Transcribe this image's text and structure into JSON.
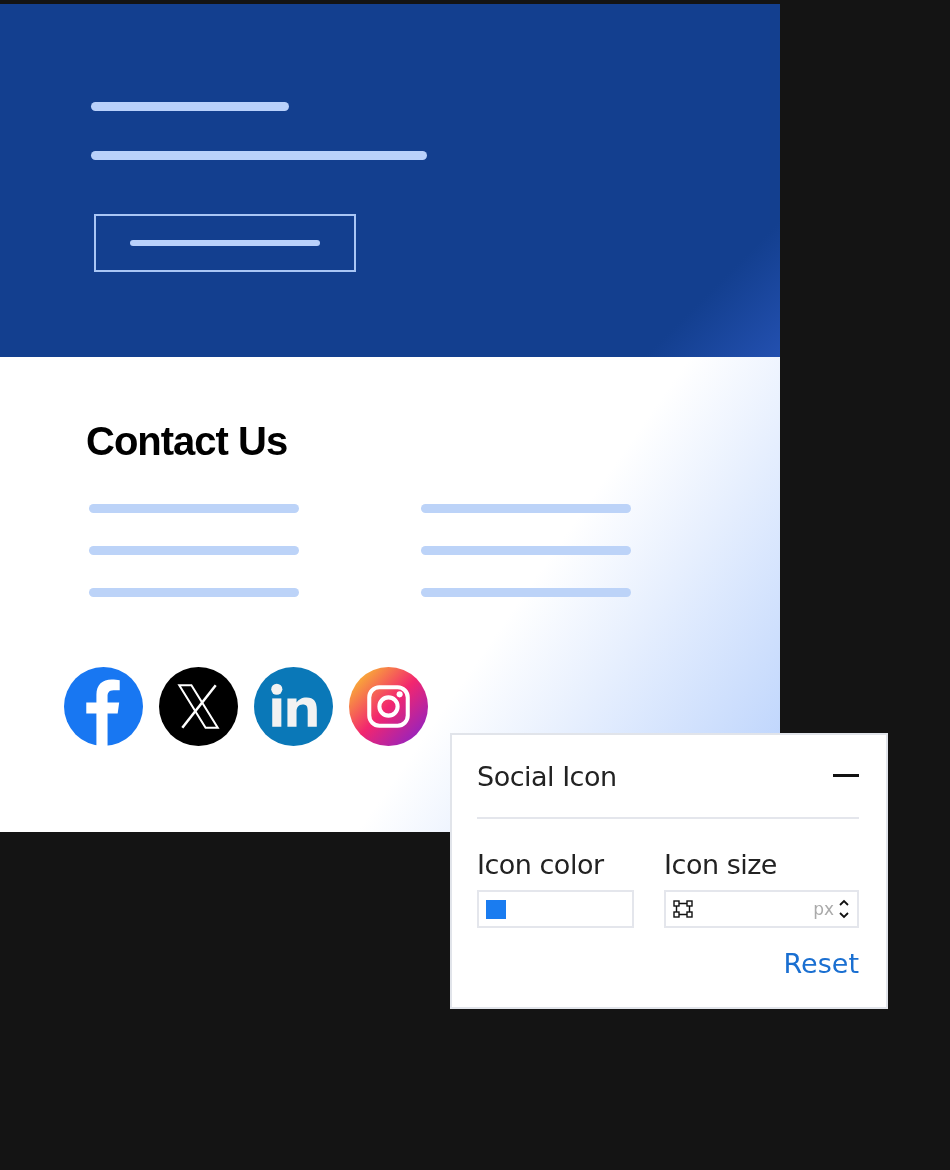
{
  "contact": {
    "heading": "Contact Us",
    "socials": [
      {
        "kind": "facebook"
      },
      {
        "kind": "x"
      },
      {
        "kind": "linkedin"
      },
      {
        "kind": "instagram"
      }
    ]
  },
  "panel": {
    "title": "Social Icon",
    "expanded": true,
    "fields": [
      {
        "kind": "color",
        "label": "Icon color",
        "color": "#1a7cf0"
      },
      {
        "kind": "size",
        "label": "Icon size",
        "unit": "px"
      }
    ],
    "reset": "Reset"
  }
}
